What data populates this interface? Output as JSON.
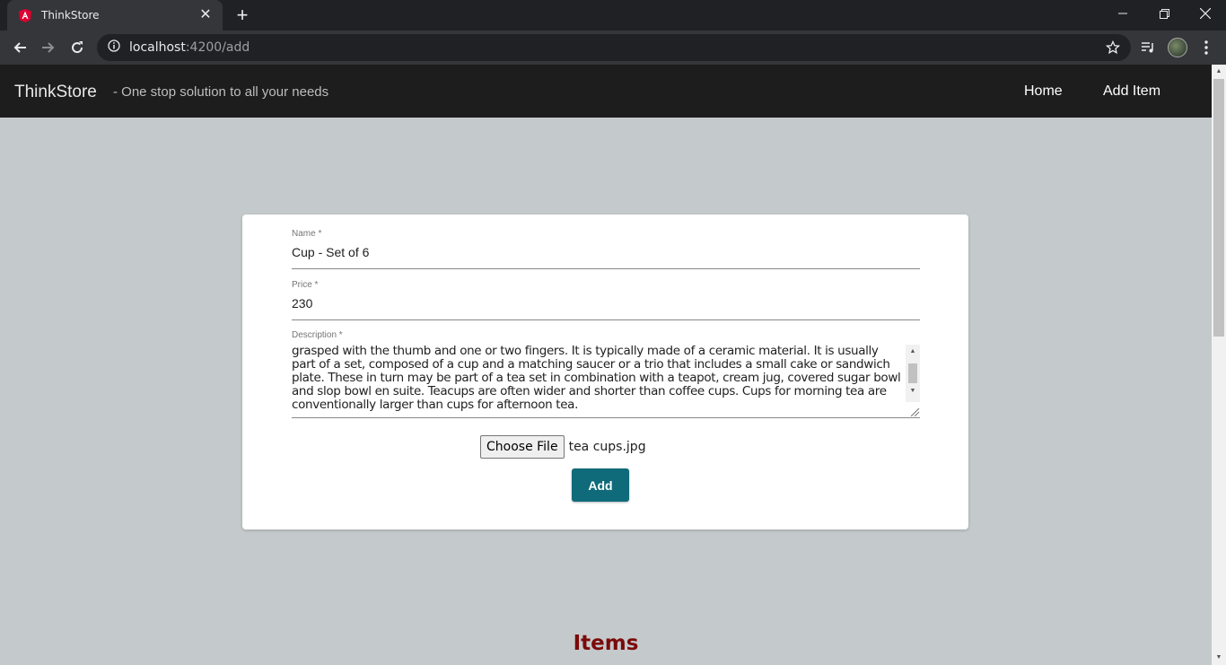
{
  "browser": {
    "tab_title": "ThinkStore",
    "url_host": "localhost",
    "url_path": ":4200/add",
    "new_tab_label": "+",
    "close_tab_label": "✕"
  },
  "navbar": {
    "brand": "ThinkStore",
    "tagline": "- One stop solution to all your needs",
    "links": [
      "Home",
      "Add Item"
    ]
  },
  "form": {
    "name_label": "Name *",
    "name_value": "Cup - Set of 6",
    "price_label": "Price *",
    "price_value": "230",
    "description_label": "Description *",
    "description_value": "grasped with the thumb and one or two fingers. It is typically made of a ceramic material. It is usually part of a set, composed of a cup and a matching saucer or a trio that includes a small cake or sandwich plate. These in turn may be part of a tea set in combination with a teapot, cream jug, covered sugar bowl and slop bowl en suite. Teacups are often wider and shorter than coffee cups. Cups for morning tea are conventionally larger than cups for afternoon tea.",
    "file_button": "Choose File",
    "file_name": "tea cups.jpg",
    "submit_label": "Add"
  },
  "items_heading": "Items",
  "colors": {
    "navbar": "#1d1d1d",
    "page_bg": "#c4cacb",
    "accent": "#0f6b7a",
    "heading": "#7b0a0a"
  }
}
